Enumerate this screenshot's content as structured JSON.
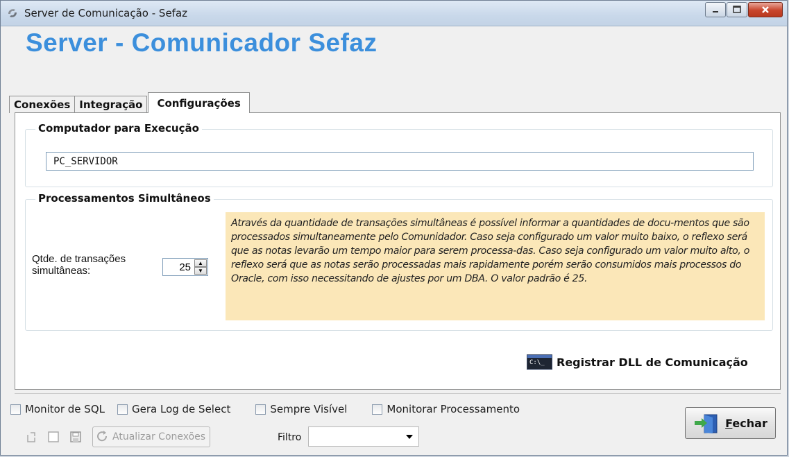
{
  "window": {
    "title": "Server de Comunicação - Sefaz",
    "app_title": "Server - Comunicador Sefaz"
  },
  "tabs": [
    {
      "label": "Conexões"
    },
    {
      "label": "Integração"
    },
    {
      "label": "Configurações"
    }
  ],
  "config": {
    "computer_group_label": "Computador para Execução",
    "computer_value": "PC_SERVIDOR",
    "processing_group_label": "Processamentos Simultâneos",
    "qtde_label": "Qtde. de transações simultâneas:",
    "qtde_value": "25",
    "info_text": "Através da quantidade de transações simultâneas é possível informar a quantidades de docu-mentos que são processados simultaneamente pelo Comunidador. Caso seja configurado um valor muito baixo, o reflexo será que as notas levarão um tempo maior para  serem processa-das. Caso seja configurado um valor muito alto, o reflexo será que as notas  serão processadas mais rapidamente porém serão consumidos mais processos do Oracle, com isso necessitando de ajustes por um DBA. O valor padrão é 25.",
    "register_label": "Registrar DLL de Comunicação",
    "cmd_icon_text": "C:\\_"
  },
  "bottom": {
    "checkboxes": [
      {
        "label": "Monitor de SQL",
        "checked": false
      },
      {
        "label": "Gera Log de Select",
        "checked": false
      },
      {
        "label": "Sempre Visível",
        "checked": false
      },
      {
        "label": "Monitorar Processamento",
        "checked": false
      }
    ],
    "refresh_label": "Atualizar Conexões",
    "filtro_label": "Filtro",
    "filtro_value": "",
    "close_label_first": "F",
    "close_label_rest": "echar"
  },
  "colors": {
    "accent_title": "#3c8fdc",
    "info_bg": "#fbe7b8",
    "close_button_red": "#c8452c"
  }
}
